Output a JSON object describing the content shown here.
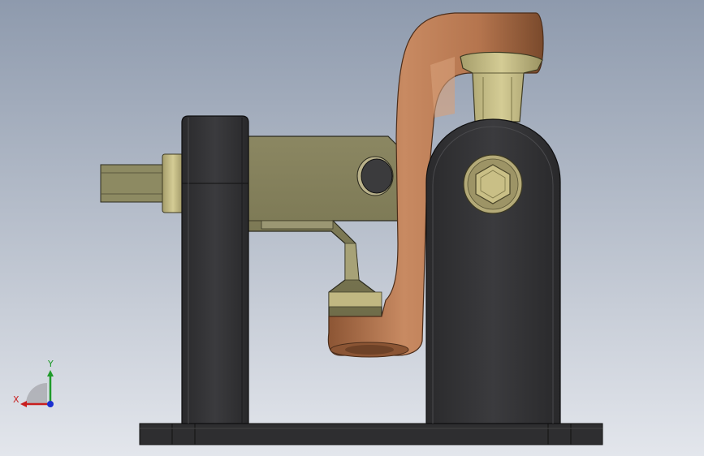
{
  "viewport": {
    "colors": {
      "background_top": "#8e9aad",
      "background_bottom": "#e3e6ec",
      "base_plate": "#2f2f31",
      "support_dark": "#333335",
      "clamp_arm_olive": "#7d7a55",
      "copper_link": "#b5754e",
      "fastener_tan": "#c9bf86"
    }
  },
  "triad": {
    "x_label": "X",
    "y_label": "Y",
    "x_color": "#c81e1e",
    "y_color": "#1f9a2a",
    "z_color": "#1a2fd0"
  },
  "model": {
    "parts": [
      "base-plate",
      "left-support",
      "right-support",
      "clamp-arm",
      "copper-link",
      "handle-spindle",
      "socket-head-bolt",
      "pivot-pin",
      "collar-bushing"
    ]
  }
}
